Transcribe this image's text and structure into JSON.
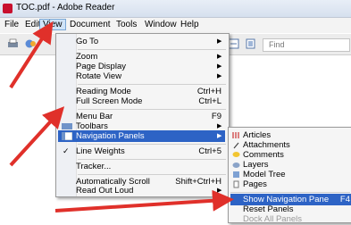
{
  "window": {
    "title": "TOC.pdf - Adobe Reader"
  },
  "menubar": [
    "File",
    "Edit",
    "View",
    "Document",
    "Tools",
    "Window",
    "Help"
  ],
  "toolbar": {
    "find_placeholder": "Find"
  },
  "view_menu": {
    "items": [
      {
        "label": "Go To",
        "shortcut": "",
        "submenu": true
      },
      {
        "label": "Zoom",
        "shortcut": "",
        "submenu": true
      },
      {
        "label": "Page Display",
        "shortcut": "",
        "submenu": true
      },
      {
        "label": "Rotate View",
        "shortcut": "",
        "submenu": true
      },
      {
        "label": "Reading Mode",
        "shortcut": "Ctrl+H",
        "submenu": false
      },
      {
        "label": "Full Screen Mode",
        "shortcut": "Ctrl+L",
        "submenu": false
      },
      {
        "label": "Menu Bar",
        "shortcut": "F9",
        "submenu": false
      },
      {
        "label": "Toolbars",
        "shortcut": "",
        "submenu": true
      },
      {
        "label": "Navigation Panels",
        "shortcut": "",
        "submenu": true,
        "highlighted": true
      },
      {
        "label": "Line Weights",
        "shortcut": "Ctrl+5",
        "submenu": false,
        "checked": true
      },
      {
        "label": "Tracker...",
        "shortcut": "",
        "submenu": false
      },
      {
        "label": "Automatically Scroll",
        "shortcut": "Shift+Ctrl+H",
        "submenu": false
      },
      {
        "label": "Read Out Loud",
        "shortcut": "",
        "submenu": true
      }
    ]
  },
  "nav_panels_menu": {
    "items": [
      {
        "label": "Articles",
        "icon": "articles-icon"
      },
      {
        "label": "Attachments",
        "icon": "paperclip-icon"
      },
      {
        "label": "Comments",
        "icon": "comment-bubble-icon"
      },
      {
        "label": "Layers",
        "icon": "layers-icon"
      },
      {
        "label": "Model Tree",
        "icon": "model-tree-icon"
      },
      {
        "label": "Pages",
        "icon": "pages-icon"
      }
    ],
    "show_pane": {
      "label": "Show Navigation Pane",
      "shortcut": "F4"
    },
    "reset": {
      "label": "Reset Panels"
    },
    "dock": {
      "label": "Dock All Panels"
    }
  },
  "colors": {
    "highlight": "#2d63c5",
    "annotation_arrow": "#e0302a"
  }
}
